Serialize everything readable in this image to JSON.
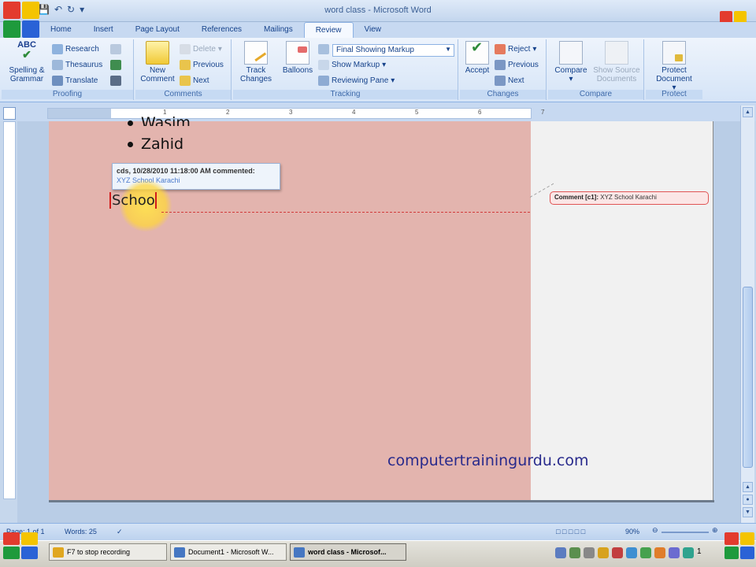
{
  "window": {
    "title": "word class - Microsoft Word"
  },
  "tabs": [
    "Home",
    "Insert",
    "Page Layout",
    "References",
    "Mailings",
    "Review",
    "View"
  ],
  "active_tab": "Review",
  "ribbon": {
    "proofing": {
      "label": "Proofing",
      "spelling": "Spelling & Grammar",
      "research": "Research",
      "thesaurus": "Thesaurus",
      "translate": "Translate"
    },
    "comments": {
      "label": "Comments",
      "new_comment": "New Comment",
      "delete": "Delete",
      "previous": "Previous",
      "next": "Next"
    },
    "tracking": {
      "label": "Tracking",
      "track_changes": "Track Changes",
      "balloons": "Balloons",
      "markup_mode": "Final Showing Markup",
      "show_markup": "Show Markup",
      "reviewing_pane": "Reviewing Pane"
    },
    "changes": {
      "label": "Changes",
      "accept": "Accept",
      "reject": "Reject",
      "previous": "Previous",
      "next": "Next"
    },
    "compare": {
      "label": "Compare",
      "compare": "Compare",
      "show_source": "Show Source Documents"
    },
    "protect": {
      "label": "Protect",
      "protect_document": "Protect Document"
    }
  },
  "ruler_ticks": [
    "1",
    "2",
    "3",
    "4",
    "5",
    "6",
    "7"
  ],
  "document": {
    "bullets": [
      "Wasim",
      "Zahid"
    ],
    "comment_tooltip": {
      "header": "cds, 10/28/2010 11:18:00 AM commented:",
      "body": "XYZ School Karachi"
    },
    "current_text": "Schoo",
    "balloon": {
      "label": "Comment [c1]:",
      "text": "XYZ School Karachi"
    },
    "watermark": "computertrainingurdu.com"
  },
  "statusbar": {
    "page": "Page: 1 of 1",
    "words": "Words: 25",
    "zoom": "90%"
  },
  "taskbar": {
    "items": [
      "F7 to stop recording",
      "Document1 - Microsoft W...",
      "word class - Microsof..."
    ],
    "clock": "1"
  },
  "colors": {
    "page_background": "#e3b4ae",
    "markup_pane": "#f1f1f1",
    "watermark": "#282a8c",
    "comment_border": "#e05454"
  }
}
